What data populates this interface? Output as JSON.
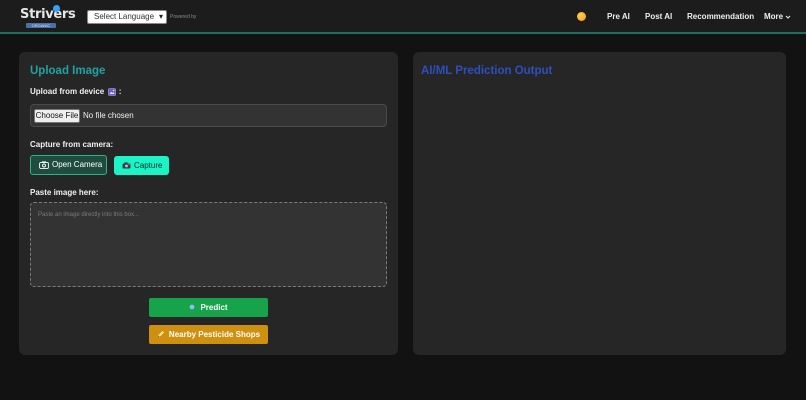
{
  "header": {
    "logo_text": "Strivers",
    "logo_subtext": "ORGANIC",
    "language_select": {
      "selected": "Select Language",
      "options": [
        "Select Language"
      ]
    },
    "powered_by": "Powered by",
    "theme_icon": "sun-icon",
    "nav": [
      {
        "label": "Pre AI"
      },
      {
        "label": "Post AI"
      },
      {
        "label": "Recommendation"
      },
      {
        "label": "More"
      }
    ],
    "more_icon": "chevron-down-icon"
  },
  "upload": {
    "title": "Upload Image",
    "device_label": "Upload from device",
    "device_icon": "image-icon",
    "device_colon": ":",
    "choose_file_label": "Choose File",
    "file_status": "No file chosen",
    "camera_label": "Capture from camera:",
    "open_camera_label": "Open Camera",
    "open_camera_icon": "camera-icon",
    "capture_label": "Capture",
    "capture_icon": "camera-flash-icon",
    "paste_label": "Paste image here:",
    "paste_placeholder": "Paste an image directly into this box...",
    "predict_label": "Predict",
    "predict_icon": "dot-icon",
    "shops_label": "Nearby Pesticide Shops",
    "shops_icon": "pencil-icon"
  },
  "output": {
    "title": "AI/ML Prediction Output"
  },
  "colors": {
    "background": "#121212",
    "header_bg": "#1c1c1c",
    "header_border": "#1f6f5f",
    "card_bg": "#262626",
    "upload_title": "#1fa3a3",
    "output_title": "#2d4fbf",
    "capture_btn": "#19f5c7",
    "predict_btn": "#16a34a",
    "shops_btn": "#cf8f0f"
  }
}
